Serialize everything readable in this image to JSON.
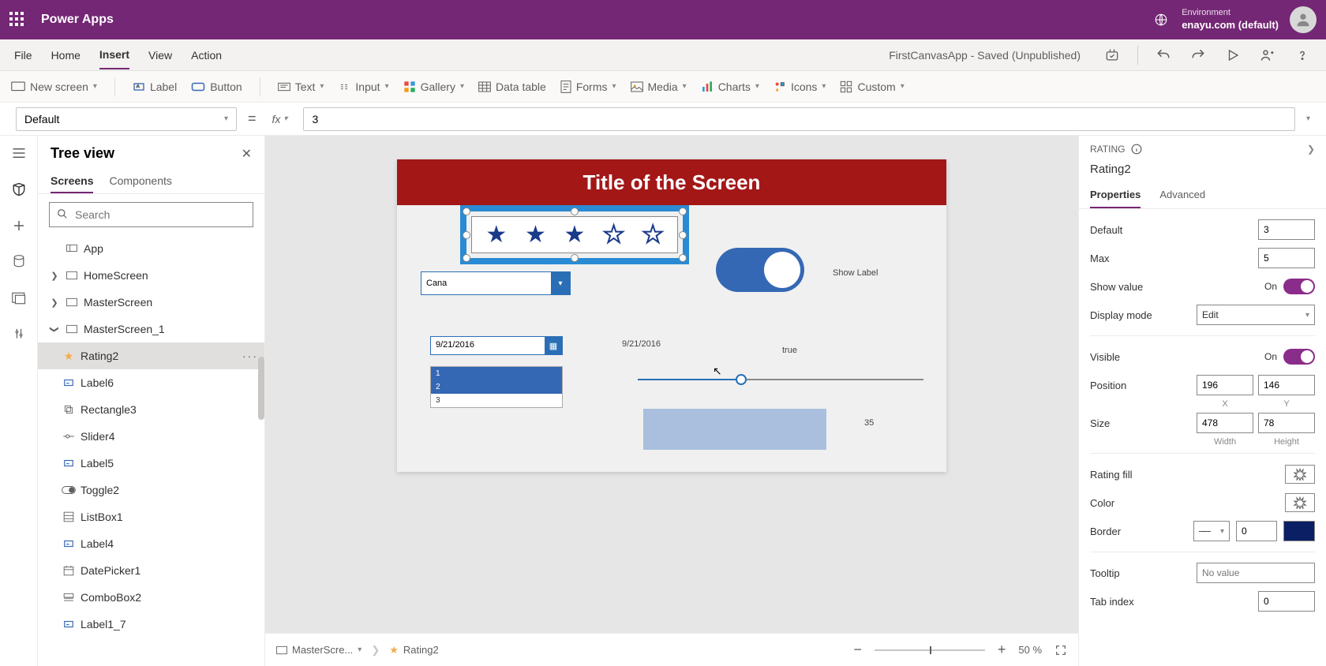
{
  "header": {
    "appName": "Power Apps",
    "envLabel": "Environment",
    "envName": "enayu.com (default)"
  },
  "menu": {
    "items": [
      "File",
      "Home",
      "Insert",
      "View",
      "Action"
    ],
    "active": "Insert",
    "status": "FirstCanvasApp - Saved (Unpublished)"
  },
  "ribbon": {
    "newScreen": "New screen",
    "label": "Label",
    "button": "Button",
    "text": "Text",
    "input": "Input",
    "gallery": "Gallery",
    "dataTable": "Data table",
    "forms": "Forms",
    "media": "Media",
    "charts": "Charts",
    "icons": "Icons",
    "custom": "Custom"
  },
  "formula": {
    "property": "Default",
    "value": "3"
  },
  "tree": {
    "title": "Tree view",
    "tabs": [
      "Screens",
      "Components"
    ],
    "activeTab": "Screens",
    "searchPlaceholder": "Search",
    "app": "App",
    "homeScreen": "HomeScreen",
    "masterScreen": "MasterScreen",
    "masterScreen1": "MasterScreen_1",
    "items": {
      "rating2": "Rating2",
      "label6": "Label6",
      "rectangle3": "Rectangle3",
      "slider4": "Slider4",
      "label5": "Label5",
      "toggle2": "Toggle2",
      "listbox1": "ListBox1",
      "label4": "Label4",
      "datepicker1": "DatePicker1",
      "combobox2": "ComboBox2",
      "label1_7": "Label1_7"
    }
  },
  "canvas": {
    "title": "Title of the Screen",
    "comboValue": "Cana",
    "showLabel": "Show Label",
    "date": "9/21/2016",
    "dateLabel": "9/21/2016",
    "list": [
      "1",
      "2",
      "3"
    ],
    "trueLbl": "true",
    "num35": "35",
    "bcScreen": "MasterScre...",
    "bcControl": "Rating2",
    "zoom": "50",
    "zoomPct": "%"
  },
  "props": {
    "cat": "RATING",
    "selected": "Rating2",
    "tabs": [
      "Properties",
      "Advanced"
    ],
    "activeTab": "Properties",
    "default": {
      "label": "Default",
      "value": "3"
    },
    "max": {
      "label": "Max",
      "value": "5"
    },
    "showValue": {
      "label": "Show value",
      "state": "On"
    },
    "displayMode": {
      "label": "Display mode",
      "value": "Edit"
    },
    "visible": {
      "label": "Visible",
      "state": "On"
    },
    "position": {
      "label": "Position",
      "x": "196",
      "y": "146",
      "xl": "X",
      "yl": "Y"
    },
    "size": {
      "label": "Size",
      "w": "478",
      "h": "78",
      "wl": "Width",
      "hl": "Height"
    },
    "ratingFill": {
      "label": "Rating fill"
    },
    "color": {
      "label": "Color"
    },
    "border": {
      "label": "Border",
      "value": "0"
    },
    "tooltip": {
      "label": "Tooltip",
      "placeholder": "No value"
    },
    "tabIndex": {
      "label": "Tab index",
      "value": "0"
    }
  }
}
